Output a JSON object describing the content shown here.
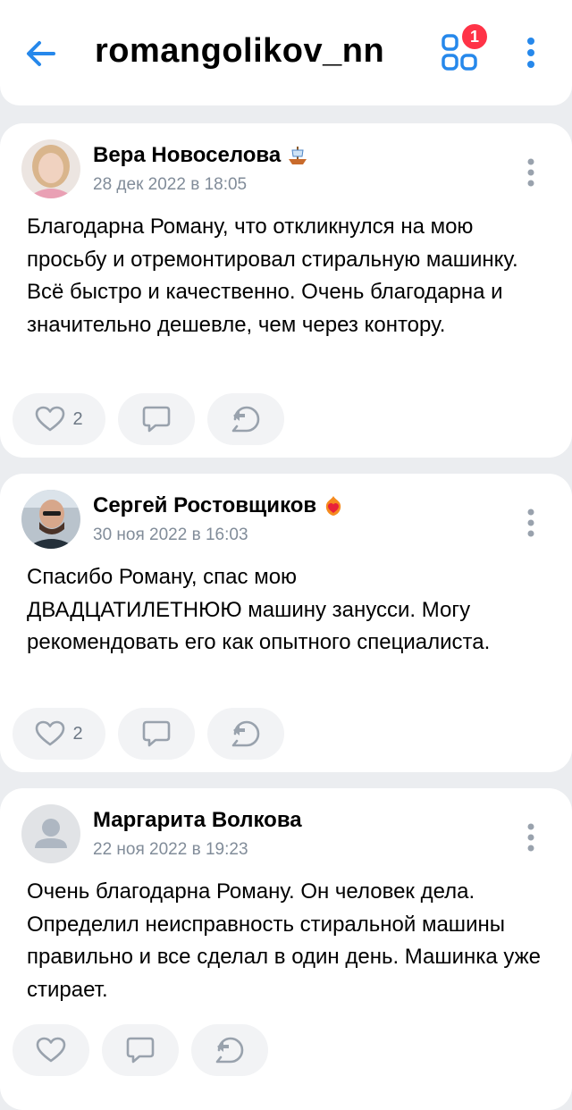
{
  "header": {
    "title": "romangolikov_nn",
    "apps_badge": "1"
  },
  "posts": [
    {
      "author": "Вера Новоселова",
      "date": "28 дек 2022 в 18:05",
      "text": "Благодарна Роману, что откликнулся на мою просьбу и отремонтировал стиральную машинку. Всё быстро и качественно. Очень благодарна и значительно дешевле, чем через контору.",
      "likes": "2"
    },
    {
      "author": "Сергей Ростовщиков",
      "date": "30 ноя 2022 в 16:03",
      "text": "Спасибо Роману, спас мою ДВАДЦАТИЛЕТНЮЮ машину занусси. Могу рекомендовать его как опытного специалиста.",
      "likes": "2"
    },
    {
      "author": "Маргарита Волкова",
      "date": "22 ноя 2022 в 19:23",
      "text": "Очень благодарна Роману. Он человек дела. Определил неисправность стиральной машины правильно и все сделал в один день. Машинка уже стирает."
    }
  ],
  "colors": {
    "accent": "#2688eb",
    "badge": "#ff3347",
    "icon_gray": "#99a2ad",
    "date_gray": "#818c99",
    "background": "#ebedf0"
  },
  "icons": [
    "arrow-left-icon",
    "apps-grid-icon",
    "more-vertical-icon",
    "heart-icon",
    "comment-icon",
    "share-icon",
    "ship-emoji-icon",
    "heart-fire-emoji-icon",
    "default-avatar-icon"
  ]
}
